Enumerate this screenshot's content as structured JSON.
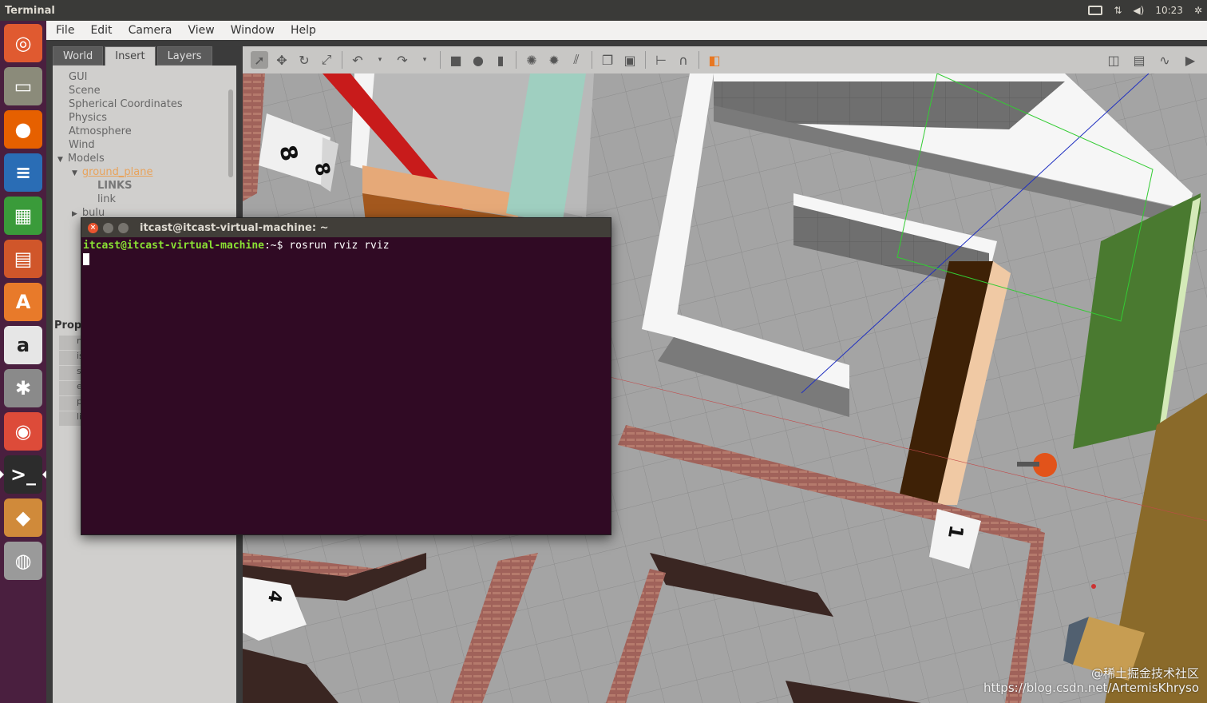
{
  "topbar": {
    "app_title": "Terminal",
    "clock": "10:23",
    "tray_icons": [
      "keyboard-icon",
      "network-icon",
      "volume-icon",
      "gear-icon"
    ]
  },
  "launcher": {
    "items": [
      {
        "name": "ubuntu-dash-icon",
        "glyph": "◎",
        "color": "#e05a30"
      },
      {
        "name": "files-icon",
        "glyph": "▭",
        "color": "#8b8b7a"
      },
      {
        "name": "firefox-icon",
        "glyph": "●",
        "color": "#e66000"
      },
      {
        "name": "writer-icon",
        "glyph": "≡",
        "color": "#2a6db5"
      },
      {
        "name": "calc-icon",
        "glyph": "▦",
        "color": "#3a9b3a"
      },
      {
        "name": "impress-icon",
        "glyph": "▤",
        "color": "#d0562a"
      },
      {
        "name": "software-center-icon",
        "glyph": "A",
        "color": "#e87a2a"
      },
      {
        "name": "amazon-icon",
        "glyph": "a",
        "color": "#e6e6e6"
      },
      {
        "name": "settings-icon",
        "glyph": "✱",
        "color": "#8a8a8a"
      },
      {
        "name": "chrome-icon",
        "glyph": "◉",
        "color": "#dd4b39"
      },
      {
        "name": "terminal-icon",
        "glyph": ">_",
        "color": "#2c2c2c"
      },
      {
        "name": "gazebo-icon",
        "glyph": "◆",
        "color": "#d08a3a"
      },
      {
        "name": "dvd-icon",
        "glyph": "◍",
        "color": "#9a9a9a"
      }
    ]
  },
  "menubar": [
    "File",
    "Edit",
    "Camera",
    "View",
    "Window",
    "Help"
  ],
  "tabs": [
    "World",
    "Insert",
    "Layers"
  ],
  "tree": {
    "gui": "GUI",
    "scene": "Scene",
    "spherical": "Spherical Coordinates",
    "physics": "Physics",
    "atmosphere": "Atmosphere",
    "wind": "Wind",
    "models": "Models",
    "ground_plane": "ground_plane",
    "links": "LINKS",
    "link": "link",
    "bulu": "bulu"
  },
  "props": {
    "header": "Prop",
    "rows": [
      "n",
      "is",
      "s",
      "e",
      "p",
      "li"
    ]
  },
  "terminal": {
    "title": "itcast@itcast-virtual-machine: ~",
    "prompt_user": "itcast@itcast-virtual-machine",
    "prompt_path": ":~$",
    "command": " rosrun rviz rviz"
  },
  "scene": {
    "labels": [
      "8",
      "8",
      "1",
      "4"
    ]
  },
  "watermark": {
    "line1": "@稀土掘金技术社区",
    "line2": "https://blog.csdn.net/ArtemisKhryso"
  }
}
